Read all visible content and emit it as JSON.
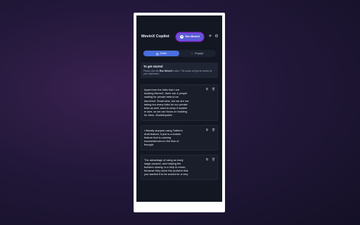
{
  "app": {
    "title": "MevinX Copilot"
  },
  "header": {
    "run_label": "Run MevinX",
    "icons": [
      "sun-icon",
      "gear-icon"
    ]
  },
  "tabs": [
    {
      "label": "Drafts",
      "icon": "drafts-icon",
      "active": true
    },
    {
      "label": "Engage",
      "icon": "heart-icon",
      "active": false
    }
  ],
  "notice": {
    "title": "To get started",
    "text_before": "Please click the ",
    "text_bold": "Run MevinX",
    "text_after": " button. This action will get all tweets for your dashboard."
  },
  "drafts": [
    {
      "text": "Apart from the folks that I am\nbuilding MevinX, there are 4 people\nwaiting for private beta to be\nlaunched. Small wins, but we are not\ntaking too many folks for our private\nbeta as well, want to keep it smaller\nin size, so we can focus on building\nfor them. #buildinpublic"
    },
    {
      "text": "I literally stopped using Twitter's\ndraft feature, it just is a broken\nfeature that is causing\ninconsistencies in the flow of\nthought."
    },
    {
      "text": "The advantage of using an early\nstage product, and helping the\nbuilders closely, is a help in return,\nbecause they solve the problem that\nyou wanted it to be solved for a very"
    }
  ],
  "colors": {
    "accent": "#4a6fe0",
    "run_button": "#5b5bd6",
    "panel": "#131722"
  }
}
